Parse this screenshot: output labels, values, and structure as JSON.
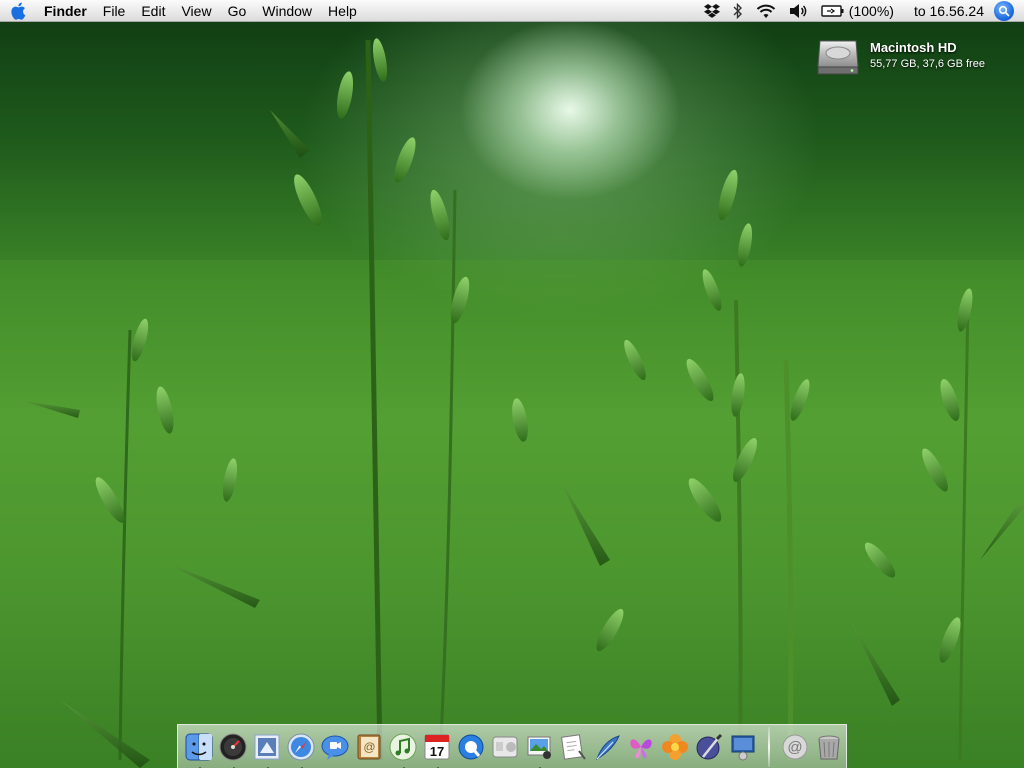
{
  "menubar": {
    "apple_icon": "apple-icon",
    "app_name": "Finder",
    "items": [
      "File",
      "Edit",
      "View",
      "Go",
      "Window",
      "Help"
    ],
    "status": {
      "dropbox_icon": "dropbox-icon",
      "bluetooth_icon": "bluetooth-icon",
      "wifi_icon": "wifi-icon",
      "volume_icon": "volume-icon",
      "battery_icon": "battery-icon",
      "battery_percent": "(100%)",
      "clock": "to 16.56.24",
      "spotlight_icon": "spotlight-icon"
    }
  },
  "desktop": {
    "disk": {
      "name": "Macintosh HD",
      "info": "55,77 GB, 37,6 GB free"
    }
  },
  "dock": {
    "apps": [
      {
        "icon": "finder-icon",
        "running": true
      },
      {
        "icon": "dashboard-icon",
        "running": true
      },
      {
        "icon": "mail-stamp-icon",
        "running": true
      },
      {
        "icon": "safari-icon",
        "running": true
      },
      {
        "icon": "ichat-icon",
        "running": false
      },
      {
        "icon": "address-book-icon",
        "running": false
      },
      {
        "icon": "itunes-icon",
        "running": true
      },
      {
        "icon": "ical-icon",
        "running": true
      },
      {
        "icon": "quicktime-icon",
        "running": false
      },
      {
        "icon": "apple-hardware-icon",
        "running": false
      },
      {
        "icon": "iphoto-icon",
        "running": true
      },
      {
        "icon": "preview-icon",
        "running": false
      },
      {
        "icon": "feather-icon",
        "running": false
      },
      {
        "icon": "butterfly-icon",
        "running": false
      },
      {
        "icon": "flower-icon",
        "running": false
      },
      {
        "icon": "script-editor-icon",
        "running": false
      },
      {
        "icon": "system-preferences-icon",
        "running": false
      }
    ],
    "calendar_day": "17",
    "docs": [
      {
        "icon": "downloads-at-icon"
      },
      {
        "icon": "trash-icon"
      }
    ]
  },
  "colors": {
    "menubar_bg": "#ececec",
    "spotlight_blue": "#1f6fe0",
    "grass_green": "#4b9430",
    "dock_bg": "#d8ded8"
  }
}
